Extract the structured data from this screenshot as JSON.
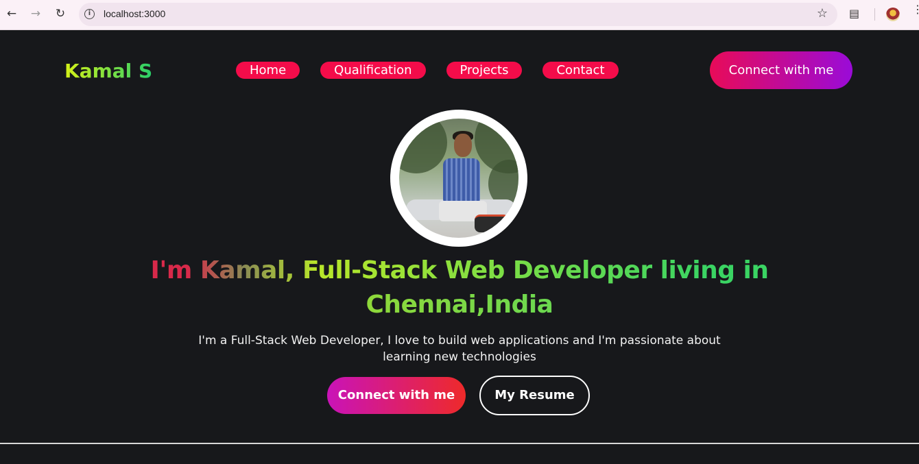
{
  "browser": {
    "url": "localhost:3000",
    "icons": [
      "back-icon",
      "forward-icon",
      "reload-icon",
      "site-info-icon",
      "bookmark-star-icon",
      "extensions-icon",
      "profile-avatar",
      "menu-icon"
    ]
  },
  "header": {
    "logo": "Kamal S",
    "nav": [
      "Home",
      "Qualification",
      "Projects",
      "Contact"
    ],
    "connect_button": "Connect with me"
  },
  "hero": {
    "headline_line1": "I'm Kamal, Full-Stack Web Developer living in",
    "headline_line2": "Chennai,India",
    "subtitle_line1": "I'm a Full-Stack Web Developer, I love to build web applications and I'm passionate about",
    "subtitle_line2": "learning new technologies",
    "connect_button": "Connect with me",
    "resume_button": "My Resume"
  },
  "colors": {
    "background": "#17181b",
    "nav_pill": "#f40c4a",
    "accent_green": "#28cf6a",
    "accent_yellow": "#d6f118"
  }
}
